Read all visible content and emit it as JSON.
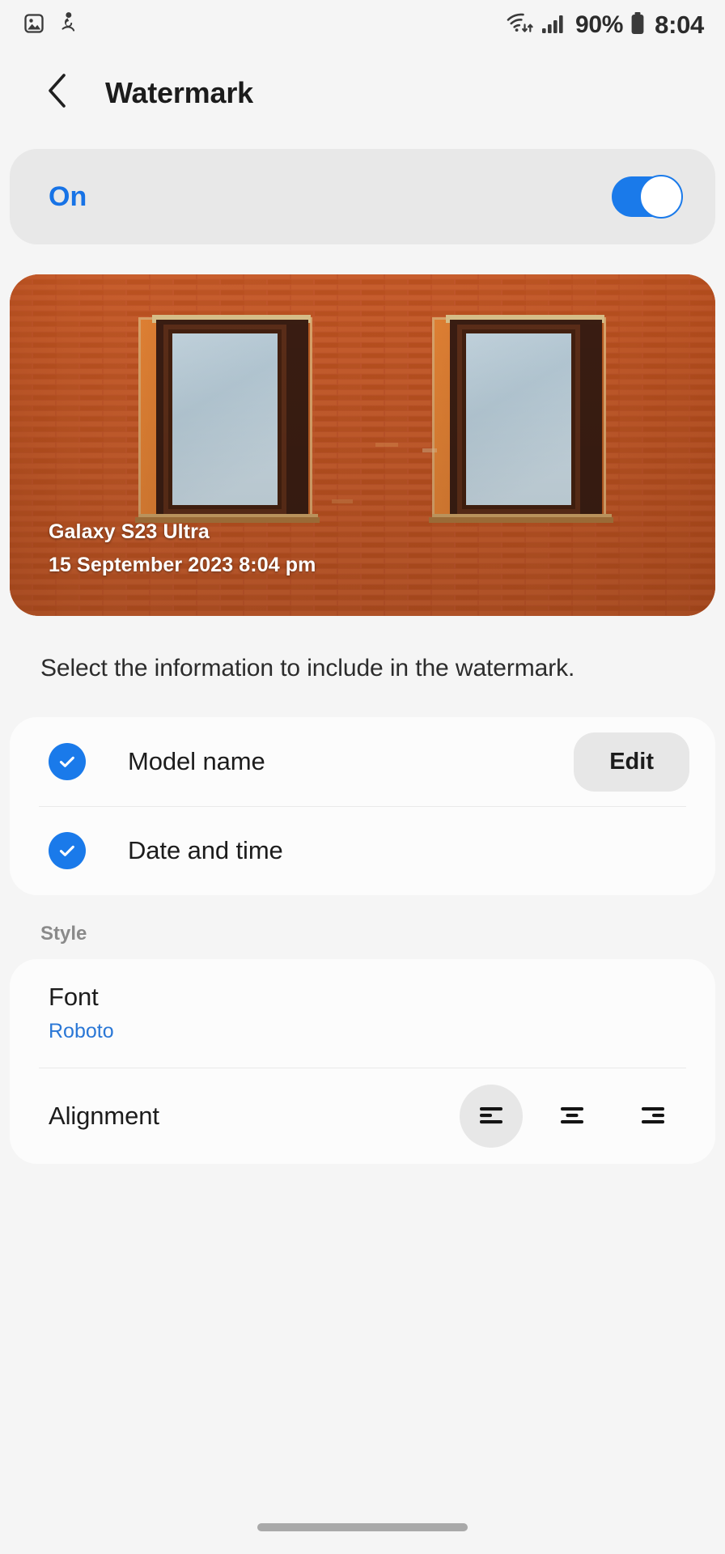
{
  "statusbar": {
    "left_icons": [
      {
        "name": "gallery-icon",
        "label": "Gallery"
      },
      {
        "name": "person-activity-icon",
        "label": "Activity"
      }
    ],
    "right_icons": [
      {
        "name": "wifi-icon",
        "label": "Wi-Fi"
      },
      {
        "name": "signal-bars-icon",
        "label": "Mobile signal"
      },
      {
        "name": "battery-icon",
        "label": "Battery"
      }
    ],
    "battery_percent": "90%",
    "clock": "8:04"
  },
  "appbar": {
    "back_icon": "chevron-left-icon",
    "title": "Watermark"
  },
  "master_toggle": {
    "label": "On",
    "state": "on",
    "accent_color": "#1a7aea"
  },
  "preview": {
    "watermark_line1": "Galaxy S23 Ultra",
    "watermark_line2": "15 September 2023 8:04 pm",
    "alt": "Red brick wall with two tall windows"
  },
  "description": "Select the information to include in the watermark.",
  "options": {
    "items": [
      {
        "label": "Model name",
        "checked": true,
        "action_label": "Edit"
      },
      {
        "label": "Date and time",
        "checked": true,
        "action_label": ""
      }
    ]
  },
  "style": {
    "section_title": "Style",
    "font": {
      "title": "Font",
      "value": "Roboto"
    },
    "alignment": {
      "title": "Alignment",
      "options": [
        {
          "name": "align-left-icon",
          "label": "Left",
          "selected": true
        },
        {
          "name": "align-center-icon",
          "label": "Center",
          "selected": false
        },
        {
          "name": "align-right-icon",
          "label": "Right",
          "selected": false
        }
      ]
    }
  },
  "navbar": {
    "handle_label": "Home gesture handle"
  },
  "colors": {
    "page_background": "#f5f5f5",
    "card_background": "#fcfcfc",
    "toggle_card_background": "#e8e8e8",
    "accent_blue": "#1a7aea",
    "link_blue": "#2a77d6",
    "text_primary": "#1c1c1c",
    "text_secondary": "#8a8a8a"
  }
}
